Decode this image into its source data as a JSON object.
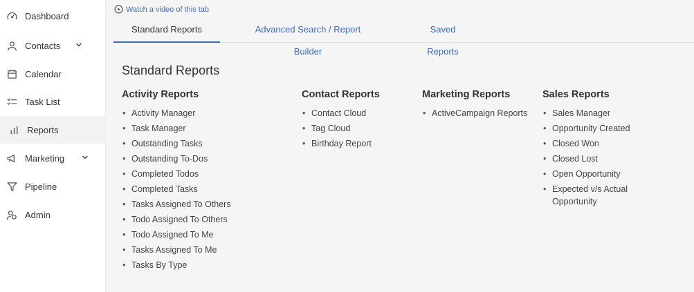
{
  "sidebar": {
    "items": [
      {
        "label": "Dashboard",
        "icon": "speedometer-icon",
        "chevron": false
      },
      {
        "label": "Contacts",
        "icon": "person-icon",
        "chevron": true
      },
      {
        "label": "Calendar",
        "icon": "calendar-icon",
        "chevron": false
      },
      {
        "label": "Task List",
        "icon": "checklist-icon",
        "chevron": false
      },
      {
        "label": "Reports",
        "icon": "bar-chart-icon",
        "chevron": false,
        "active": true
      },
      {
        "label": "Marketing",
        "icon": "megaphone-icon",
        "chevron": true
      },
      {
        "label": "Pipeline",
        "icon": "funnel-icon",
        "chevron": false
      },
      {
        "label": "Admin",
        "icon": "users-icon",
        "chevron": false
      }
    ]
  },
  "main": {
    "video_link": "Watch a video of this tab",
    "tabs": [
      {
        "label": "Standard Reports",
        "active": true
      },
      {
        "label": "Advanced Search / Report Builder",
        "active": false
      },
      {
        "label": "Saved Reports",
        "active": false
      }
    ],
    "page_title": "Standard Reports",
    "columns": [
      {
        "title": "Activity Reports",
        "items": [
          "Activity Manager",
          "Task Manager",
          "Outstanding Tasks",
          "Outstanding To-Dos",
          "Completed Todos",
          "Completed Tasks",
          "Tasks Assigned To Others",
          "Todo Assigned To Others",
          "Todo Assigned To Me",
          "Tasks Assigned To Me",
          "Tasks By Type"
        ]
      },
      {
        "title": "Contact Reports",
        "items": [
          "Contact Cloud",
          "Tag Cloud",
          "Birthday Report"
        ]
      },
      {
        "title": "Marketing Reports",
        "items": [
          "ActiveCampaign Reports"
        ]
      },
      {
        "title": "Sales Reports",
        "items": [
          "Sales Manager",
          "Opportunity Created",
          "Closed Won",
          "Closed Lost",
          "Open Opportunity",
          "Expected v/s Actual Opportunity"
        ]
      }
    ]
  },
  "colors": {
    "link": "#3d6bb3",
    "text": "#333333",
    "sidebar_bg": "#ffffff",
    "main_bg": "#f5f5f5"
  }
}
